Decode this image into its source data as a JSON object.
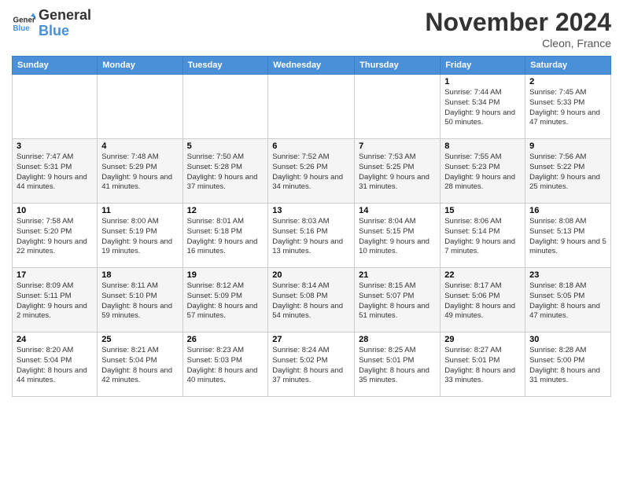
{
  "logo": {
    "line1": "General",
    "line2": "Blue"
  },
  "title": "November 2024",
  "location": "Cleon, France",
  "headers": [
    "Sunday",
    "Monday",
    "Tuesday",
    "Wednesday",
    "Thursday",
    "Friday",
    "Saturday"
  ],
  "weeks": [
    [
      {
        "day": "",
        "info": ""
      },
      {
        "day": "",
        "info": ""
      },
      {
        "day": "",
        "info": ""
      },
      {
        "day": "",
        "info": ""
      },
      {
        "day": "",
        "info": ""
      },
      {
        "day": "1",
        "info": "Sunrise: 7:44 AM\nSunset: 5:34 PM\nDaylight: 9 hours\nand 50 minutes."
      },
      {
        "day": "2",
        "info": "Sunrise: 7:45 AM\nSunset: 5:33 PM\nDaylight: 9 hours\nand 47 minutes."
      }
    ],
    [
      {
        "day": "3",
        "info": "Sunrise: 7:47 AM\nSunset: 5:31 PM\nDaylight: 9 hours\nand 44 minutes."
      },
      {
        "day": "4",
        "info": "Sunrise: 7:48 AM\nSunset: 5:29 PM\nDaylight: 9 hours\nand 41 minutes."
      },
      {
        "day": "5",
        "info": "Sunrise: 7:50 AM\nSunset: 5:28 PM\nDaylight: 9 hours\nand 37 minutes."
      },
      {
        "day": "6",
        "info": "Sunrise: 7:52 AM\nSunset: 5:26 PM\nDaylight: 9 hours\nand 34 minutes."
      },
      {
        "day": "7",
        "info": "Sunrise: 7:53 AM\nSunset: 5:25 PM\nDaylight: 9 hours\nand 31 minutes."
      },
      {
        "day": "8",
        "info": "Sunrise: 7:55 AM\nSunset: 5:23 PM\nDaylight: 9 hours\nand 28 minutes."
      },
      {
        "day": "9",
        "info": "Sunrise: 7:56 AM\nSunset: 5:22 PM\nDaylight: 9 hours\nand 25 minutes."
      }
    ],
    [
      {
        "day": "10",
        "info": "Sunrise: 7:58 AM\nSunset: 5:20 PM\nDaylight: 9 hours\nand 22 minutes."
      },
      {
        "day": "11",
        "info": "Sunrise: 8:00 AM\nSunset: 5:19 PM\nDaylight: 9 hours\nand 19 minutes."
      },
      {
        "day": "12",
        "info": "Sunrise: 8:01 AM\nSunset: 5:18 PM\nDaylight: 9 hours\nand 16 minutes."
      },
      {
        "day": "13",
        "info": "Sunrise: 8:03 AM\nSunset: 5:16 PM\nDaylight: 9 hours\nand 13 minutes."
      },
      {
        "day": "14",
        "info": "Sunrise: 8:04 AM\nSunset: 5:15 PM\nDaylight: 9 hours\nand 10 minutes."
      },
      {
        "day": "15",
        "info": "Sunrise: 8:06 AM\nSunset: 5:14 PM\nDaylight: 9 hours\nand 7 minutes."
      },
      {
        "day": "16",
        "info": "Sunrise: 8:08 AM\nSunset: 5:13 PM\nDaylight: 9 hours\nand 5 minutes."
      }
    ],
    [
      {
        "day": "17",
        "info": "Sunrise: 8:09 AM\nSunset: 5:11 PM\nDaylight: 9 hours\nand 2 minutes."
      },
      {
        "day": "18",
        "info": "Sunrise: 8:11 AM\nSunset: 5:10 PM\nDaylight: 8 hours\nand 59 minutes."
      },
      {
        "day": "19",
        "info": "Sunrise: 8:12 AM\nSunset: 5:09 PM\nDaylight: 8 hours\nand 57 minutes."
      },
      {
        "day": "20",
        "info": "Sunrise: 8:14 AM\nSunset: 5:08 PM\nDaylight: 8 hours\nand 54 minutes."
      },
      {
        "day": "21",
        "info": "Sunrise: 8:15 AM\nSunset: 5:07 PM\nDaylight: 8 hours\nand 51 minutes."
      },
      {
        "day": "22",
        "info": "Sunrise: 8:17 AM\nSunset: 5:06 PM\nDaylight: 8 hours\nand 49 minutes."
      },
      {
        "day": "23",
        "info": "Sunrise: 8:18 AM\nSunset: 5:05 PM\nDaylight: 8 hours\nand 47 minutes."
      }
    ],
    [
      {
        "day": "24",
        "info": "Sunrise: 8:20 AM\nSunset: 5:04 PM\nDaylight: 8 hours\nand 44 minutes."
      },
      {
        "day": "25",
        "info": "Sunrise: 8:21 AM\nSunset: 5:04 PM\nDaylight: 8 hours\nand 42 minutes."
      },
      {
        "day": "26",
        "info": "Sunrise: 8:23 AM\nSunset: 5:03 PM\nDaylight: 8 hours\nand 40 minutes."
      },
      {
        "day": "27",
        "info": "Sunrise: 8:24 AM\nSunset: 5:02 PM\nDaylight: 8 hours\nand 37 minutes."
      },
      {
        "day": "28",
        "info": "Sunrise: 8:25 AM\nSunset: 5:01 PM\nDaylight: 8 hours\nand 35 minutes."
      },
      {
        "day": "29",
        "info": "Sunrise: 8:27 AM\nSunset: 5:01 PM\nDaylight: 8 hours\nand 33 minutes."
      },
      {
        "day": "30",
        "info": "Sunrise: 8:28 AM\nSunset: 5:00 PM\nDaylight: 8 hours\nand 31 minutes."
      }
    ]
  ]
}
